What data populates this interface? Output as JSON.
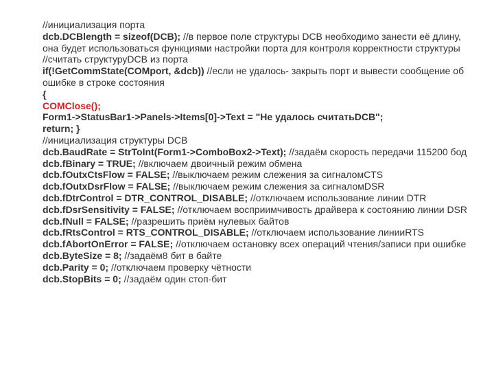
{
  "lines": [
    {
      "segments": [
        {
          "text": "//инициализация порта",
          "cls": "n"
        }
      ]
    },
    {
      "segments": [
        {
          "text": "dcb.DCBlength = sizeof(DCB);",
          "cls": "b"
        },
        {
          "text": "  //в первое поле структуры DCB необходимо занести её длину, она будет использоваться функциями настройки порта для контроля корректности структуры",
          "cls": "n"
        }
      ]
    },
    {
      "segments": [
        {
          "text": "//считать структуруDCB из порта",
          "cls": "n"
        }
      ]
    },
    {
      "segments": [
        {
          "text": "if(!GetCommState(COMport, &dcb))",
          "cls": "b"
        },
        {
          "text": " //если не удалось- закрыть порт и вывести сообщение об ошибке в строке состояния",
          "cls": "n"
        }
      ]
    },
    {
      "segments": [
        {
          "text": "{",
          "cls": "b"
        }
      ]
    },
    {
      "segments": [
        {
          "text": "COMClose();",
          "cls": "red"
        }
      ]
    },
    {
      "segments": [
        {
          "text": "Form1->StatusBar1->Panels->Items[0]->Text = \"Не удалось считатьDCB\";",
          "cls": "b"
        }
      ]
    },
    {
      "segments": [
        {
          "text": "return;  }",
          "cls": "b"
        }
      ]
    },
    {
      "segments": [
        {
          "text": "//инициализация структуры DCB",
          "cls": "n"
        }
      ]
    },
    {
      "segments": [
        {
          "text": "dcb.BaudRate = StrToInt(Form1->ComboBox2->Text);",
          "cls": "b"
        },
        {
          "text": "  //задаём скорость передачи 115200 бод",
          "cls": "n"
        }
      ]
    },
    {
      "segments": [
        {
          "text": "dcb.fBinary = TRUE;",
          "cls": "b"
        },
        {
          "text": "  //включаем двоичный режим обмена",
          "cls": "n"
        }
      ]
    },
    {
      "segments": [
        {
          "text": "dcb.fOutxCtsFlow = FALSE;",
          "cls": "b"
        },
        {
          "text": "  //выключаем режим слежения за сигналомCTS",
          "cls": "n"
        }
      ]
    },
    {
      "segments": [
        {
          "text": "dcb.fOutxDsrFlow = FALSE;",
          "cls": "b"
        },
        {
          "text": "  //выключаем режим слежения за сигналомDSR",
          "cls": "n"
        }
      ]
    },
    {
      "segments": [
        {
          "text": "dcb.fDtrControl = DTR_CONTROL_DISABLE;",
          "cls": "b"
        },
        {
          "text": "  //отключаем использование линии DTR",
          "cls": "n"
        }
      ]
    },
    {
      "segments": [
        {
          "text": "dcb.fDsrSensitivity = FALSE;",
          "cls": "b"
        },
        {
          "text": "  //отключаем восприимчивость драйвера к состоянию линии DSR",
          "cls": "n"
        }
      ]
    },
    {
      "segments": [
        {
          "text": "dcb.fNull = FALSE;",
          "cls": "b"
        },
        {
          "text": "  //разрешить приём нулевых байтов",
          "cls": "n"
        }
      ]
    },
    {
      "segments": [
        {
          "text": "dcb.fRtsControl = RTS_CONTROL_DISABLE;",
          "cls": "b"
        },
        {
          "text": "  //отключаем использование линииRTS",
          "cls": "n"
        }
      ]
    },
    {
      "segments": [
        {
          "text": "dcb.fAbortOnError = FALSE;",
          "cls": "b"
        },
        {
          "text": "  //отключаем остановку всех операций чтения/записи при ошибке",
          "cls": "n"
        }
      ]
    },
    {
      "segments": [
        {
          "text": "dcb.ByteSize = 8;",
          "cls": "b"
        },
        {
          "text": "  //задаём8 бит в байте",
          "cls": "n"
        }
      ]
    },
    {
      "segments": [
        {
          "text": "dcb.Parity = 0;",
          "cls": "b"
        },
        {
          "text": "  //отключаем проверку чётности",
          "cls": "n"
        }
      ]
    },
    {
      "segments": [
        {
          "text": "dcb.StopBits = 0;",
          "cls": "b"
        },
        {
          "text": "  //задаём один стоп-бит",
          "cls": "n"
        }
      ]
    }
  ]
}
